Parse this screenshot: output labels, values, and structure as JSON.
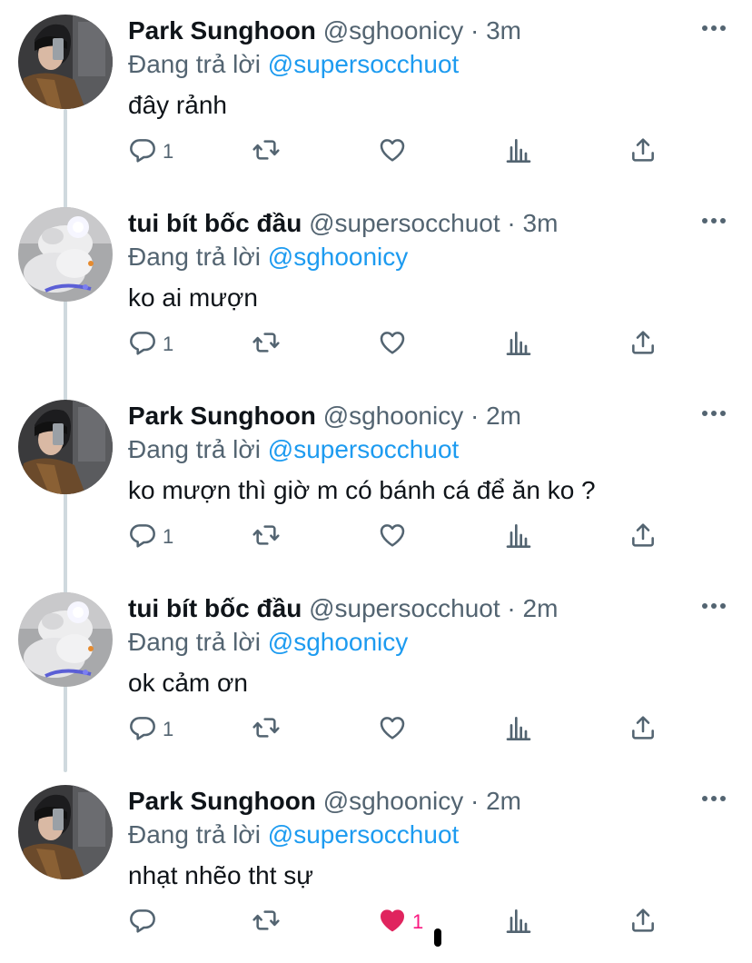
{
  "tweets": [
    {
      "name": "Park Sunghoon",
      "handle": "@sghoonicy",
      "separator": "·",
      "time": "3m",
      "replying_prefix": "Đang trả lời",
      "replying_to": "@supersocchuot",
      "text": "đây rảnh",
      "reply_count": "1",
      "like_count": "",
      "liked": false,
      "avatar": "sunghoon"
    },
    {
      "name": "tui bít bốc đầu",
      "handle": "@supersocchuot",
      "separator": "·",
      "time": "3m",
      "replying_prefix": "Đang trả lời",
      "replying_to": "@sghoonicy",
      "text": "ko ai mượn",
      "reply_count": "1",
      "like_count": "",
      "liked": false,
      "avatar": "mouse"
    },
    {
      "name": "Park Sunghoon",
      "handle": "@sghoonicy",
      "separator": "·",
      "time": "2m",
      "replying_prefix": "Đang trả lời",
      "replying_to": "@supersocchuot",
      "text": "ko mượn thì giờ m có bánh cá để ăn ko ?",
      "reply_count": "1",
      "like_count": "",
      "liked": false,
      "avatar": "sunghoon"
    },
    {
      "name": "tui bít bốc đầu",
      "handle": "@supersocchuot",
      "separator": "·",
      "time": "2m",
      "replying_prefix": "Đang trả lời",
      "replying_to": "@sghoonicy",
      "text": "ok cảm ơn",
      "reply_count": "1",
      "like_count": "",
      "liked": false,
      "avatar": "mouse"
    },
    {
      "name": "Park Sunghoon",
      "handle": "@sghoonicy",
      "separator": "·",
      "time": "2m",
      "replying_prefix": "Đang trả lời",
      "replying_to": "@supersocchuot",
      "text": "nhạt nhẽo tht sự",
      "reply_count": "",
      "like_count": "1",
      "liked": true,
      "avatar": "sunghoon"
    }
  ],
  "icons": {
    "reply": "reply-icon",
    "retweet": "retweet-icon",
    "like": "heart-icon",
    "stats": "analytics-icon",
    "share": "share-icon",
    "more": "more-icon"
  },
  "colors": {
    "text": "#0f1419",
    "secondary": "#536471",
    "mention": "#1d9bf0",
    "like_active": "#f91880",
    "thread_line": "#cfd9de"
  }
}
